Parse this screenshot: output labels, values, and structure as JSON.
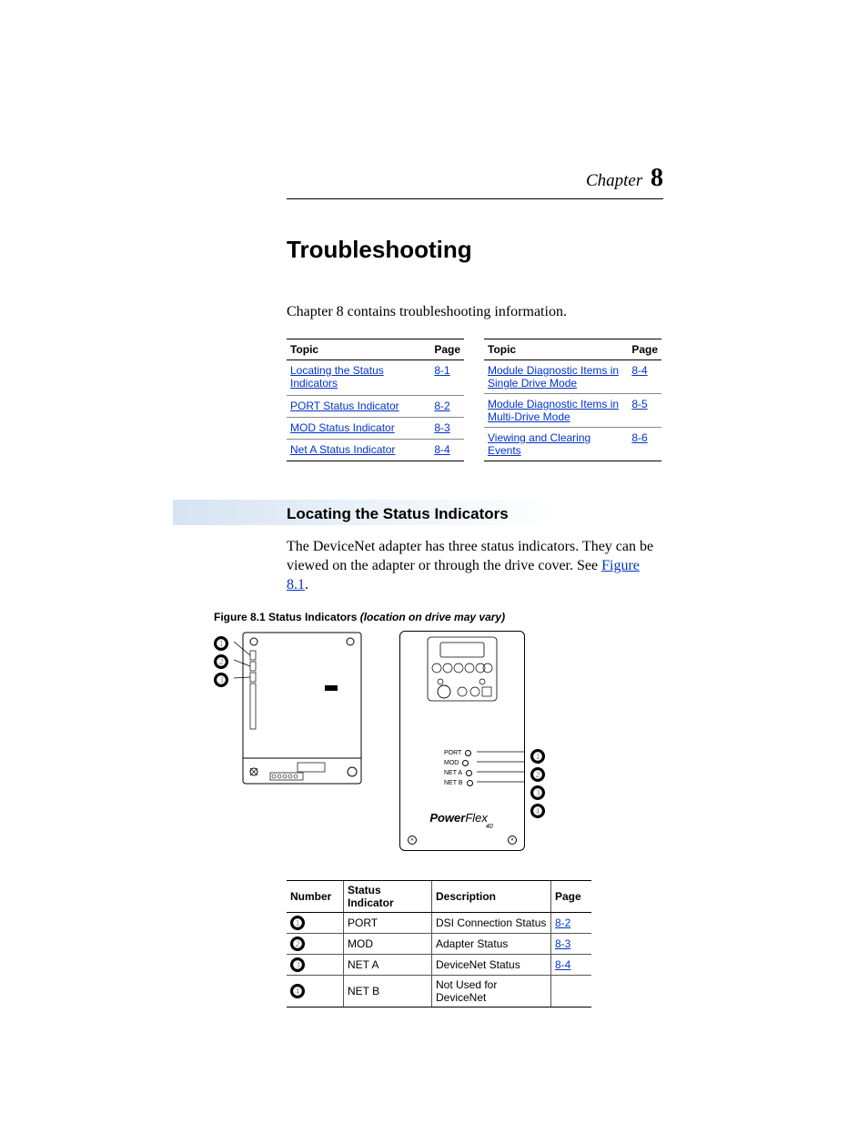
{
  "chapter": {
    "label": "Chapter",
    "number": "8"
  },
  "title": "Troubleshooting",
  "intro": "Chapter 8 contains troubleshooting information.",
  "toc": {
    "headers": {
      "topic": "Topic",
      "page": "Page"
    },
    "left": [
      {
        "topic": "Locating the Status Indicators",
        "page": "8-1"
      },
      {
        "topic": "PORT Status Indicator",
        "page": "8-2"
      },
      {
        "topic": "MOD Status Indicator",
        "page": "8-3"
      },
      {
        "topic": "Net A Status Indicator",
        "page": "8-4"
      }
    ],
    "right": [
      {
        "topic": "Module Diagnostic Items in Single Drive Mode",
        "page": "8-4"
      },
      {
        "topic": "Module Diagnostic Items in Multi-Drive Mode",
        "page": "8-5"
      },
      {
        "topic": "Viewing and Clearing Events",
        "page": "8-6"
      }
    ]
  },
  "section1": {
    "heading": "Locating the Status Indicators",
    "body_a": "The DeviceNet adapter has three status indicators. They can be viewed on the adapter or through the drive cover. See ",
    "body_link": "Figure 8.1",
    "body_b": "."
  },
  "figure": {
    "caption_bold": "Figure 8.1   Status Indicators ",
    "caption_ital": "(location on drive may vary)",
    "leds": [
      "PORT",
      "MOD",
      "NET A",
      "NET B"
    ],
    "logo": {
      "a": "Power",
      "b": "Flex",
      "sub": "40"
    }
  },
  "callouts": {
    "1": "➊",
    "2": "➋",
    "3": "➌",
    "4": "➍"
  },
  "indic_table": {
    "headers": {
      "num": "Number",
      "si": "Status Indicator",
      "desc": "Description",
      "page": "Page"
    },
    "rows": [
      {
        "n": "➊",
        "si": "PORT",
        "desc": "DSI Connection Status",
        "page": "8-2"
      },
      {
        "n": "➋",
        "si": "MOD",
        "desc": "Adapter Status",
        "page": "8-3"
      },
      {
        "n": "➌",
        "si": "NET A",
        "desc": "DeviceNet Status",
        "page": "8-4"
      },
      {
        "n": "➍",
        "si": "NET B",
        "desc": "Not Used for DeviceNet",
        "page": ""
      }
    ]
  }
}
